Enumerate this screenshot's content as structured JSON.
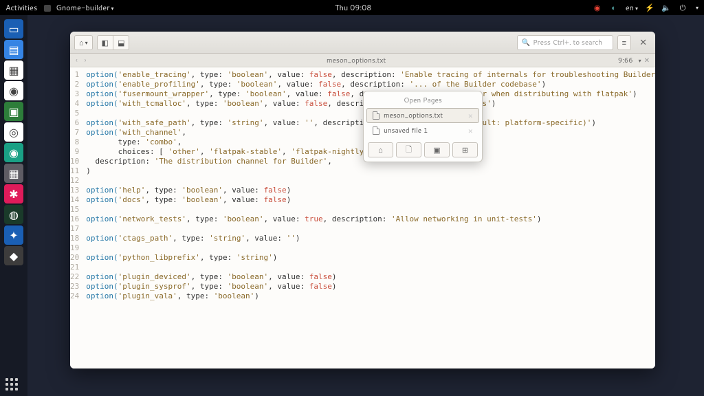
{
  "topbar": {
    "activities": "Activities",
    "app_menu": "Gnome-builder",
    "clock": "Thu 09:08",
    "lang": "en"
  },
  "dock": {
    "items": [
      {
        "name": "files",
        "bg": "#1a5fb4",
        "glyph": "▭"
      },
      {
        "name": "text-editor",
        "bg": "#3584e4",
        "glyph": "▤"
      },
      {
        "name": "calendar",
        "bg": "#ffffff",
        "glyph": "▦"
      },
      {
        "name": "chrome",
        "bg": "#ffffff",
        "glyph": "◉"
      },
      {
        "name": "terminal",
        "bg": "#2d7d3a",
        "glyph": "▣"
      },
      {
        "name": "settings",
        "bg": "#ffffff",
        "glyph": "◎"
      },
      {
        "name": "spiral",
        "bg": "#1aa085",
        "glyph": "◉"
      },
      {
        "name": "calculator",
        "bg": "#5e5c64",
        "glyph": "▦"
      },
      {
        "name": "candy",
        "bg": "#e01b5a",
        "glyph": "✱"
      },
      {
        "name": "globe",
        "bg": "#1a3a2a",
        "glyph": "◍"
      },
      {
        "name": "navigator",
        "bg": "#1a5fb4",
        "glyph": "✦"
      },
      {
        "name": "inkscape",
        "bg": "#3d3c3c",
        "glyph": "◆"
      }
    ]
  },
  "headerbar": {
    "search_placeholder": "Press Ctrl+. to search"
  },
  "subheader": {
    "filename": "meson_options.txt",
    "cursor": "9:66"
  },
  "popover": {
    "title": "Open Pages",
    "items": [
      "meson_options.txt",
      "unsaved file 1"
    ]
  },
  "code_lines": [
    [
      [
        "kw",
        "option("
      ],
      [
        "str",
        "'enable_tracing'"
      ],
      [
        "punct",
        ", type: "
      ],
      [
        "str",
        "'boolean'"
      ],
      [
        "punct",
        ", value: "
      ],
      [
        "bool-false",
        "false"
      ],
      [
        "punct",
        ", description: "
      ],
      [
        "str",
        "'Enable tracing of internals for troubleshooting Builder'"
      ],
      [
        "punct",
        ")"
      ]
    ],
    [
      [
        "kw",
        "option("
      ],
      [
        "str",
        "'enable_profiling'"
      ],
      [
        "punct",
        ", type: "
      ],
      [
        "str",
        "'boolean'"
      ],
      [
        "punct",
        ", value: "
      ],
      [
        "bool-false",
        "false"
      ],
      [
        "punct",
        ", description: "
      ],
      [
        "str",
        "'... of the Builder codebase'"
      ],
      [
        "punct",
        ")"
      ]
    ],
    [
      [
        "kw",
        "option("
      ],
      [
        "str",
        "'fusermount_wrapper'"
      ],
      [
        "punct",
        ", type: "
      ],
      [
        "str",
        "'boolean'"
      ],
      [
        "punct",
        ", value: "
      ],
      [
        "bool-false",
        "false"
      ],
      [
        "punct",
        ", description: "
      ],
      [
        "str",
        "'...unt-wrapper when distributing with flatpak'"
      ],
      [
        "punct",
        ")"
      ]
    ],
    [
      [
        "kw",
        "option("
      ],
      [
        "str",
        "'with_tcmalloc'"
      ],
      [
        "punct",
        ", type: "
      ],
      [
        "str",
        "'boolean'"
      ],
      [
        "punct",
        ", value: "
      ],
      [
        "bool-false",
        "false"
      ],
      [
        "punct",
        ", description: "
      ],
      [
        "str",
        "'...amic allocations'"
      ],
      [
        "punct",
        ")"
      ]
    ],
    [],
    [
      [
        "kw",
        "option("
      ],
      [
        "str",
        "'with_safe_path'"
      ],
      [
        "punct",
        ", type: "
      ],
      [
        "str",
        "'string'"
      ],
      [
        "punct",
        ", value: "
      ],
      [
        "str",
        "''"
      ],
      [
        "punct",
        ", description: "
      ],
      [
        "str",
        "'...ild commands (default: platform-specific)'"
      ],
      [
        "punct",
        ")"
      ]
    ],
    [
      [
        "kw",
        "option("
      ],
      [
        "str",
        "'with_channel'"
      ],
      [
        "punct",
        ","
      ]
    ],
    [
      [
        "punct",
        "       type: "
      ],
      [
        "str",
        "'combo'"
      ],
      [
        "punct",
        ","
      ]
    ],
    [
      [
        "punct",
        "       choices: [ "
      ],
      [
        "str",
        "'other'"
      ],
      [
        "punct",
        ", "
      ],
      [
        "str",
        "'flatpak-stable'"
      ],
      [
        "punct",
        ", "
      ],
      [
        "str",
        "'flatpak-nightly'"
      ],
      [
        "punct",
        " ],"
      ]
    ],
    [
      [
        "punct",
        "  description: "
      ],
      [
        "str",
        "'The distribution channel for Builder'"
      ],
      [
        "punct",
        ","
      ]
    ],
    [
      [
        "punct",
        ")"
      ]
    ],
    [],
    [
      [
        "kw",
        "option("
      ],
      [
        "str",
        "'help'"
      ],
      [
        "punct",
        ", type: "
      ],
      [
        "str",
        "'boolean'"
      ],
      [
        "punct",
        ", value: "
      ],
      [
        "bool-false",
        "false"
      ],
      [
        "punct",
        ")"
      ]
    ],
    [
      [
        "kw",
        "option("
      ],
      [
        "str",
        "'docs'"
      ],
      [
        "punct",
        ", type: "
      ],
      [
        "str",
        "'boolean'"
      ],
      [
        "punct",
        ", value: "
      ],
      [
        "bool-false",
        "false"
      ],
      [
        "punct",
        ")"
      ]
    ],
    [],
    [
      [
        "kw",
        "option("
      ],
      [
        "str",
        "'network_tests'"
      ],
      [
        "punct",
        ", type: "
      ],
      [
        "str",
        "'boolean'"
      ],
      [
        "punct",
        ", value: "
      ],
      [
        "bool-true",
        "true"
      ],
      [
        "punct",
        ", description: "
      ],
      [
        "str",
        "'Allow networking in unit-tests'"
      ],
      [
        "punct",
        ")"
      ]
    ],
    [],
    [
      [
        "kw",
        "option("
      ],
      [
        "str",
        "'ctags_path'"
      ],
      [
        "punct",
        ", type: "
      ],
      [
        "str",
        "'string'"
      ],
      [
        "punct",
        ", value: "
      ],
      [
        "str",
        "''"
      ],
      [
        "punct",
        ")"
      ]
    ],
    [],
    [
      [
        "kw",
        "option("
      ],
      [
        "str",
        "'python_libprefix'"
      ],
      [
        "punct",
        ", type: "
      ],
      [
        "str",
        "'string'"
      ],
      [
        "punct",
        ")"
      ]
    ],
    [],
    [
      [
        "kw",
        "option("
      ],
      [
        "str",
        "'plugin_deviced'"
      ],
      [
        "punct",
        ", type: "
      ],
      [
        "str",
        "'boolean'"
      ],
      [
        "punct",
        ", value: "
      ],
      [
        "bool-false",
        "false"
      ],
      [
        "punct",
        ")"
      ]
    ],
    [
      [
        "kw",
        "option("
      ],
      [
        "str",
        "'plugin_sysprof'"
      ],
      [
        "punct",
        ", type: "
      ],
      [
        "str",
        "'boolean'"
      ],
      [
        "punct",
        ", value: "
      ],
      [
        "bool-false",
        "false"
      ],
      [
        "punct",
        ")"
      ]
    ],
    [
      [
        "kw",
        "option("
      ],
      [
        "str",
        "'plugin_vala'"
      ],
      [
        "punct",
        ", type: "
      ],
      [
        "str",
        "'boolean'"
      ],
      [
        "punct",
        ")"
      ]
    ]
  ]
}
